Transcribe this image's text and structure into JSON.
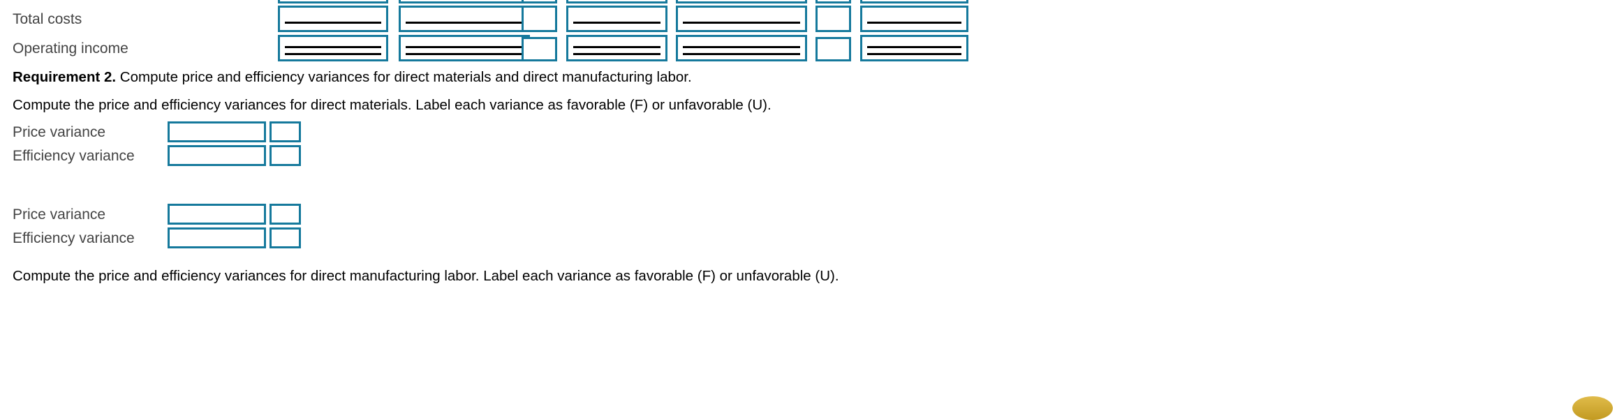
{
  "theme": {
    "input_border_color": "#15799c",
    "label_color": "#434343",
    "text_color": "#000000",
    "page_background": "#ffffff",
    "accent_widget_color": "#c9a227"
  },
  "income_statement": {
    "rows": [
      {
        "label": "Total costs",
        "rule": "single",
        "cells": [
          {
            "name": "total-costs-col-1",
            "value": "",
            "kind": "amount"
          },
          {
            "name": "total-costs-col-2",
            "value": "",
            "kind": "amount"
          },
          {
            "name": "total-costs-col-3",
            "value": "",
            "kind": "flag"
          },
          {
            "name": "total-costs-col-4",
            "value": "",
            "kind": "amount"
          },
          {
            "name": "total-costs-col-5",
            "value": "",
            "kind": "amount"
          },
          {
            "name": "total-costs-col-6",
            "value": "",
            "kind": "flag"
          },
          {
            "name": "total-costs-col-7",
            "value": "",
            "kind": "amount"
          }
        ]
      },
      {
        "label": "Operating income",
        "rule": "double",
        "cells": [
          {
            "name": "operating-income-col-1",
            "value": "",
            "kind": "amount"
          },
          {
            "name": "operating-income-col-2",
            "value": "",
            "kind": "amount"
          },
          {
            "name": "operating-income-col-3",
            "value": "",
            "kind": "flag"
          },
          {
            "name": "operating-income-col-4",
            "value": "",
            "kind": "amount"
          },
          {
            "name": "operating-income-col-5",
            "value": "",
            "kind": "amount"
          },
          {
            "name": "operating-income-col-6",
            "value": "",
            "kind": "flag"
          },
          {
            "name": "operating-income-col-7",
            "value": "",
            "kind": "amount"
          }
        ]
      }
    ]
  },
  "requirement_2": {
    "heading_bold": "Requirement 2.",
    "heading_rest": " Compute price and efficiency variances for direct materials and direct manufacturing labor.",
    "direct_materials": {
      "instruction": "Compute the price and efficiency variances for direct materials. Label each variance as favorable (F) or unfavorable (U).",
      "rows": [
        {
          "label": "Price variance",
          "amount_value": "",
          "flag_value": ""
        },
        {
          "label": "Efficiency variance",
          "amount_value": "",
          "flag_value": ""
        }
      ]
    },
    "direct_labor": {
      "instruction": "Compute the price and efficiency variances for direct manufacturing labor. Label each variance as favorable (F) or unfavorable (U).",
      "rows": [
        {
          "label": "Price variance",
          "amount_value": "",
          "flag_value": ""
        },
        {
          "label": "Efficiency variance",
          "amount_value": "",
          "flag_value": ""
        }
      ]
    }
  },
  "input_placeholder": ""
}
